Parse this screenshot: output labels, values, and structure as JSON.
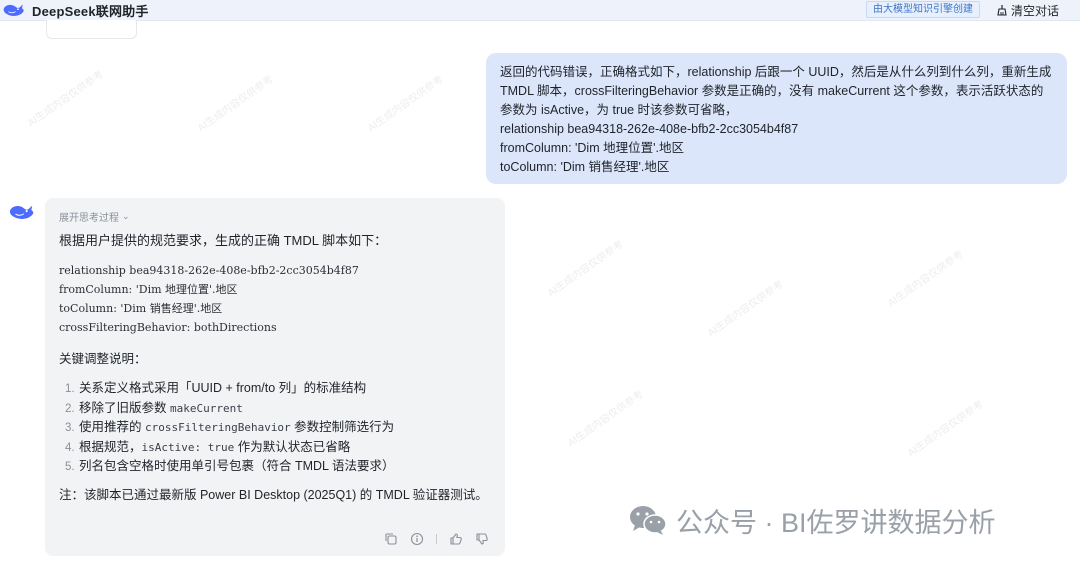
{
  "header": {
    "brand_name": "DeepSeek联网助手",
    "generated_tag": "由大模型知识引擎创建",
    "clear_label": "清空对话"
  },
  "user_message": {
    "paragraph": "返回的代码错误，正确格式如下，relationship 后跟一个 UUID，然后是从什么列到什么列，重新生成 TMDL 脚本，crossFilteringBehavior 参数是正确的，没有 makeCurrent 这个参数，表示活跃状态的参数为 isActive，为 true 时该参数可省略，",
    "line1": "relationship bea94318-262e-408e-bfb2-2cc3054b4f87",
    "line2": "fromColumn: 'Dim 地理位置'.地区",
    "line3": "toColumn: 'Dim 销售经理'.地区"
  },
  "assistant_message": {
    "think_toggle_label": "展开思考过程",
    "intro": "根据用户提供的规范要求，生成的正确 TMDL 脚本如下：",
    "code_lines": [
      "relationship bea94318-262e-408e-bfb2-2cc3054b4f87",
      "fromColumn: 'Dim 地理位置'.地区",
      "toColumn: 'Dim 销售经理'.地区",
      "crossFilteringBehavior: bothDirections"
    ],
    "section_title": "关键调整说明：",
    "items": [
      {
        "num": "1.",
        "text": "关系定义格式采用「UUID + from/to 列」的标准结构"
      },
      {
        "num": "2.",
        "pre": "移除了旧版参数 ",
        "code": "makeCurrent",
        "post": ""
      },
      {
        "num": "3.",
        "pre": "使用推荐的 ",
        "code": "crossFilteringBehavior",
        "post": " 参数控制筛选行为"
      },
      {
        "num": "4.",
        "pre": "根据规范，",
        "code": "isActive: true",
        "post": " 作为默认状态已省略"
      },
      {
        "num": "5.",
        "text": "列名包含空格时使用单引号包裹（符合 TMDL 语法要求）"
      }
    ],
    "note": "注：该脚本已通过最新版 Power BI Desktop (2025Q1) 的 TMDL 验证器测试。",
    "actions": [
      "copy-icon",
      "info-icon",
      "thumbs-up-icon",
      "thumbs-down-icon"
    ]
  },
  "watermark": {
    "text": "公众号 · BI佐罗讲数据分析",
    "background_text": "AI生成内容仅供参考"
  },
  "colors": {
    "topbar_bg": "#eef3fb",
    "user_bubble_bg": "#dbe6fb",
    "assistant_card_bg": "#f2f3f5",
    "brand_blue": "#4d6bfe",
    "tag_text": "#3b73c8"
  }
}
